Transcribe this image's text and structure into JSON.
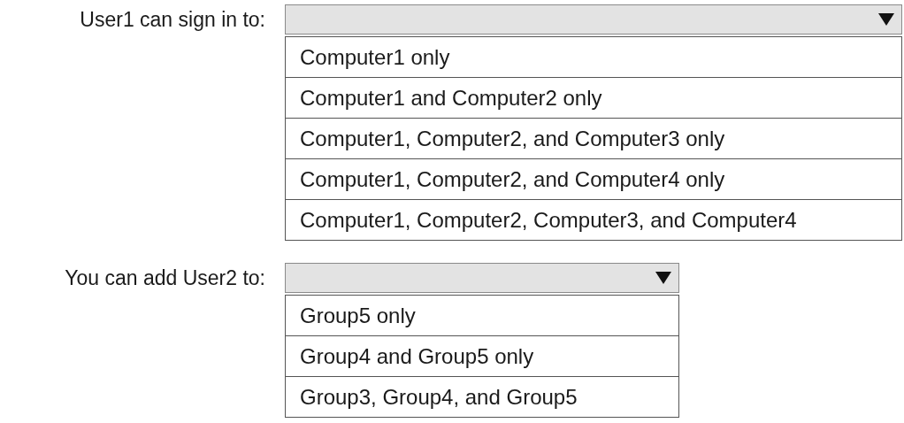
{
  "questions": [
    {
      "label": "User1 can sign in to:",
      "options": [
        "Computer1 only",
        "Computer1 and Computer2 only",
        "Computer1, Computer2, and Computer3 only",
        "Computer1, Computer2, and Computer4 only",
        "Computer1, Computer2, Computer3, and Computer4"
      ]
    },
    {
      "label": "You can add User2 to:",
      "options": [
        "Group5 only",
        "Group4 and Group5 only",
        "Group3, Group4, and Group5"
      ]
    }
  ]
}
